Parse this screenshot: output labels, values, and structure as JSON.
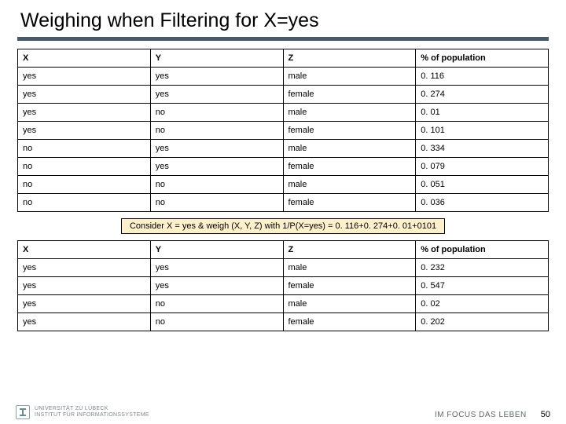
{
  "title": "Weighing when Filtering for X=yes",
  "table1": {
    "headers": [
      "X",
      "Y",
      "Z",
      "% of population"
    ],
    "rows": [
      [
        "yes",
        "yes",
        "male",
        "0. 116"
      ],
      [
        "yes",
        "yes",
        "female",
        "0. 274"
      ],
      [
        "yes",
        "no",
        "male",
        "0. 01"
      ],
      [
        "yes",
        "no",
        "female",
        "0. 101"
      ],
      [
        "no",
        "yes",
        "male",
        "0. 334"
      ],
      [
        "no",
        "yes",
        "female",
        "0. 079"
      ],
      [
        "no",
        "no",
        "male",
        "0. 051"
      ],
      [
        "no",
        "no",
        "female",
        "0. 036"
      ]
    ]
  },
  "note": "Consider X = yes  & weigh (X, Y, Z) with 1/P(X=yes) = 0. 116+0. 274+0. 01+0101",
  "table2": {
    "headers": [
      "X",
      "Y",
      "Z",
      "% of population"
    ],
    "rows": [
      [
        "yes",
        "yes",
        "male",
        "0. 232"
      ],
      [
        "yes",
        "yes",
        "female",
        "0. 547"
      ],
      [
        "yes",
        "no",
        "male",
        "0. 02"
      ],
      [
        "yes",
        "no",
        "female",
        "0. 202"
      ]
    ]
  },
  "footer": {
    "institution_line1": "UNIVERSITÄT ZU LÜBECK",
    "institution_line2": "INSTITUT FÜR INFORMATIONSSYSTEME",
    "tagline": "IM FOCUS DAS LEBEN",
    "page": "50"
  },
  "chart_data": [
    {
      "type": "table",
      "title": "Joint distribution of X, Y, Z",
      "columns": [
        "X",
        "Y",
        "Z",
        "% of population"
      ],
      "rows": [
        {
          "X": "yes",
          "Y": "yes",
          "Z": "male",
          "pct": 0.116
        },
        {
          "X": "yes",
          "Y": "yes",
          "Z": "female",
          "pct": 0.274
        },
        {
          "X": "yes",
          "Y": "no",
          "Z": "male",
          "pct": 0.01
        },
        {
          "X": "yes",
          "Y": "no",
          "Z": "female",
          "pct": 0.101
        },
        {
          "X": "no",
          "Y": "yes",
          "Z": "male",
          "pct": 0.334
        },
        {
          "X": "no",
          "Y": "yes",
          "Z": "female",
          "pct": 0.079
        },
        {
          "X": "no",
          "Y": "no",
          "Z": "male",
          "pct": 0.051
        },
        {
          "X": "no",
          "Y": "no",
          "Z": "female",
          "pct": 0.036
        }
      ]
    },
    {
      "type": "table",
      "title": "Reweighted distribution for X=yes (weight 1/P(X=yes))",
      "columns": [
        "X",
        "Y",
        "Z",
        "% of population"
      ],
      "rows": [
        {
          "X": "yes",
          "Y": "yes",
          "Z": "male",
          "pct": 0.232
        },
        {
          "X": "yes",
          "Y": "yes",
          "Z": "female",
          "pct": 0.547
        },
        {
          "X": "yes",
          "Y": "no",
          "Z": "male",
          "pct": 0.02
        },
        {
          "X": "yes",
          "Y": "no",
          "Z": "female",
          "pct": 0.202
        }
      ]
    }
  ]
}
